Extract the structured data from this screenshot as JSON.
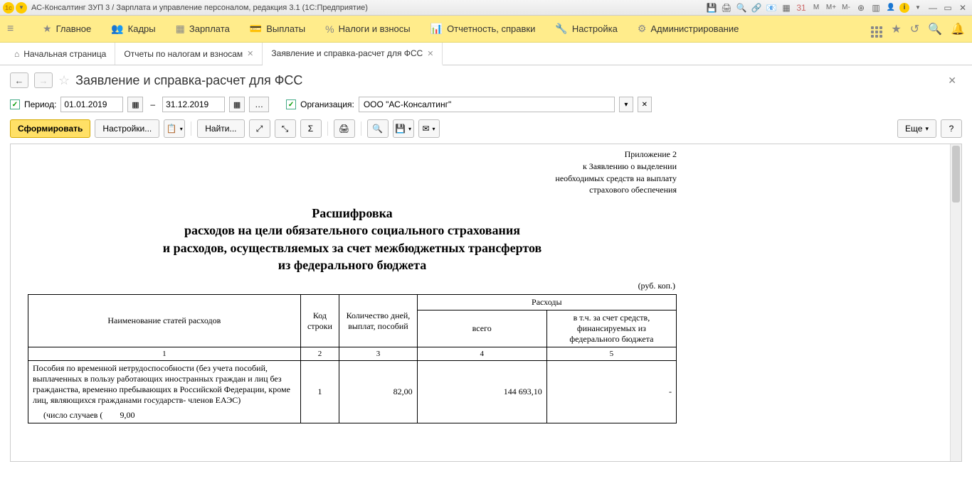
{
  "titlebar": {
    "title": "АС-Консалтинг ЗУП 3 / Зарплата и управление персоналом, редакция 3.1  (1С:Предприятие)"
  },
  "mainmenu": {
    "items": [
      {
        "icon": "★",
        "label": "Главное"
      },
      {
        "icon": "👥",
        "label": "Кадры"
      },
      {
        "icon": "▦",
        "label": "Зарплата"
      },
      {
        "icon": "💳",
        "label": "Выплаты"
      },
      {
        "icon": "%",
        "label": "Налоги и взносы"
      },
      {
        "icon": "📊",
        "label": "Отчетность, справки"
      },
      {
        "icon": "🔧",
        "label": "Настройка"
      },
      {
        "icon": "⚙",
        "label": "Администрирование"
      }
    ]
  },
  "tabs": {
    "items": [
      {
        "label": "Начальная страница",
        "home": true
      },
      {
        "label": "Отчеты по налогам и взносам",
        "closable": true
      },
      {
        "label": "Заявление и справка-расчет для ФСС",
        "closable": true,
        "active": true
      }
    ]
  },
  "page": {
    "title": "Заявление и справка-расчет для ФСС"
  },
  "filter": {
    "period_label": "Период:",
    "date_from": "01.01.2019",
    "date_to": "31.12.2019",
    "org_label": "Организация:",
    "org_value": "ООО \"АС-Консалтинг\""
  },
  "toolbar": {
    "generate": "Сформировать",
    "settings": "Настройки...",
    "find": "Найти...",
    "more": "Еще"
  },
  "doc": {
    "appendix_lines": [
      "Приложение 2",
      "к Заявлению о выделении",
      "необходимых средств на выплату",
      "страхового обеспечения"
    ],
    "title_lines": [
      "Расшифровка",
      "расходов на цели обязательного социального страхования",
      "и расходов, осуществляемых за счет межбюджетных трансфертов",
      "из федерального бюджета"
    ],
    "unit": "(руб. коп.)",
    "headers": {
      "col1": "Наименование статей расходов",
      "col2": "Код строки",
      "col3": "Количество дней, выплат, пособий",
      "col4_group": "Расходы",
      "col4": "всего",
      "col5": "в т.ч. за счет средств, финансируемых из федерального бюджета"
    },
    "numrow": [
      "1",
      "2",
      "3",
      "4",
      "5"
    ],
    "row1": {
      "name": "Пособия по временной нетрудоспособности (без учета пособий, выплаченных в пользу работающих иностранных граждан и лиц без гражданства, временно пребывающих в Российской Федерации, кроме лиц, являющихся гражданами государств- членов ЕАЭС)",
      "cases_label": "(число случаев (",
      "cases_value": "9,00",
      "code": "1",
      "days": "82,00",
      "total": "144 693,10",
      "federal": "-"
    }
  }
}
